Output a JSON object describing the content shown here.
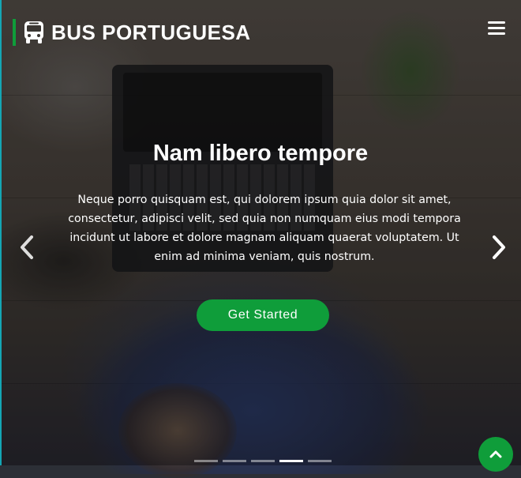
{
  "header": {
    "logo_icon": "bus-icon",
    "logo_text": "BUS PORTUGUESA",
    "menu_icon": "hamburger-menu-icon"
  },
  "carousel": {
    "title": "Nam libero tempore",
    "text": "Neque porro quisquam est, qui dolorem ipsum quia dolor sit amet, consectetur, adipisci velit, sed quia non numquam eius modi tempora incidunt ut labore et dolore magnam aliquam quaerat voluptatem. Ut enim ad minima veniam, quis nostrum.",
    "cta_label": "Get Started",
    "prev_icon": "chevron-left-icon",
    "next_icon": "chevron-right-icon",
    "slide_count": 5,
    "active_slide_index": 3
  },
  "back_to_top_icon": "chevron-up-icon",
  "colors": {
    "brand_green": "#0f9d3a",
    "accent_teal": "#14a6b4",
    "text_white": "#ffffff"
  }
}
